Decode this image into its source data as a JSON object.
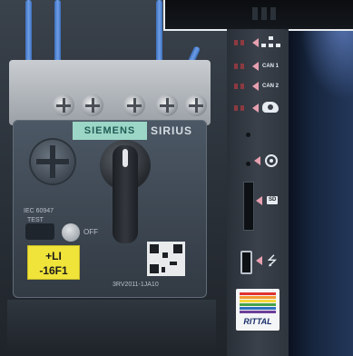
{
  "breaker": {
    "brand": "SIEMENS",
    "series": "SIRIUS",
    "tag_line1": "+LI",
    "tag_line2": "-16F1",
    "test_label": "TEST",
    "off_label": "OFF",
    "model": "3RV2011-1JA10",
    "rating": "IEC 60947"
  },
  "panel": {
    "labels": [
      "CAN 1",
      "CAN 2",
      "SD"
    ],
    "logo_text": "RITTAL",
    "icons": [
      "network-icon",
      "can1-indicator",
      "can2-indicator",
      "cloud-icon",
      "target-icon",
      "sd-card-icon",
      "usb-icon"
    ],
    "led_color": "#8d3940",
    "arrow_color": "#e7a0b0"
  }
}
